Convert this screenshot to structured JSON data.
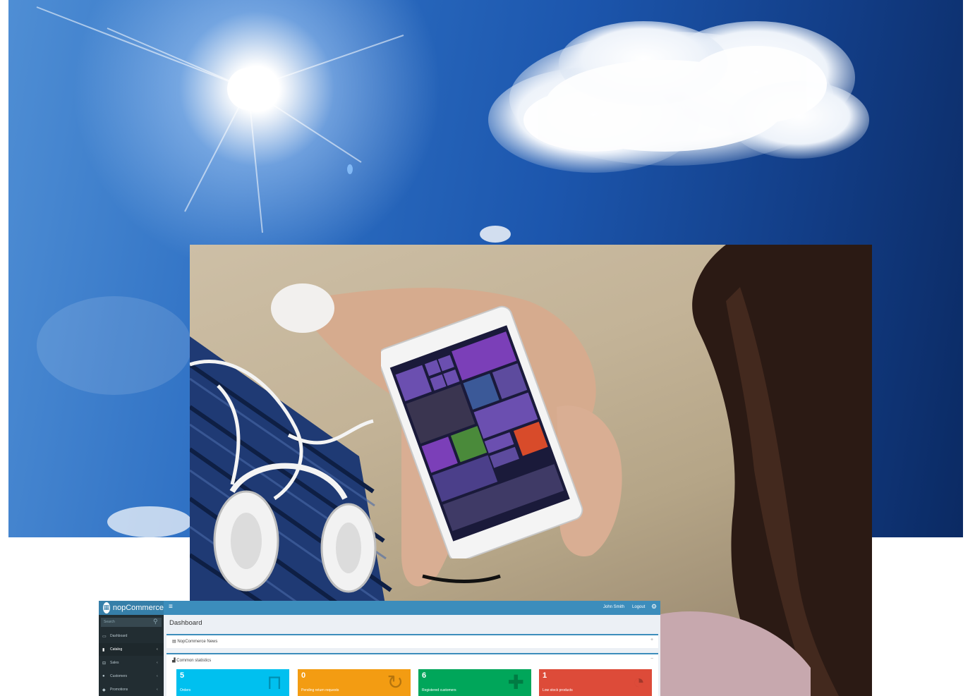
{
  "admin": {
    "logo_text": "nopCommerce",
    "menu_toggle_glyph": "≡",
    "user_name": "John Smith",
    "logout_label": "Logout",
    "gear_glyph": "⚙",
    "search_placeholder": "Search",
    "sidebar": [
      {
        "label": "Dashboard",
        "icon": "monitor-icon",
        "glyph": "▭"
      },
      {
        "label": "Catalog",
        "icon": "book-icon",
        "glyph": "▮"
      },
      {
        "label": "Sales",
        "icon": "cart-icon",
        "glyph": "⊟"
      },
      {
        "label": "Customers",
        "icon": "user-icon",
        "glyph": "●"
      },
      {
        "label": "Promotions",
        "icon": "tag-icon",
        "glyph": "◆"
      }
    ],
    "page_title": "Dashboard",
    "news_panel_title": "NopCommerce News",
    "news_toggle": "+",
    "stats_panel_title": "Common statistics",
    "stats_toggle": "−",
    "stats": [
      {
        "value": "5",
        "label": "Orders",
        "color": "#00c0ef",
        "icon": "shopping-bag-icon",
        "glyph": "⊓"
      },
      {
        "value": "0",
        "label": "Pending return requests",
        "color": "#f39c12",
        "icon": "refresh-icon",
        "glyph": "↻"
      },
      {
        "value": "6",
        "label": "Registered customers",
        "color": "#00a65a",
        "icon": "user-plus-icon",
        "glyph": "✚"
      },
      {
        "value": "1",
        "label": "Low stock products",
        "color": "#dd4b39",
        "icon": "pie-chart-icon",
        "glyph": "◔"
      }
    ]
  }
}
